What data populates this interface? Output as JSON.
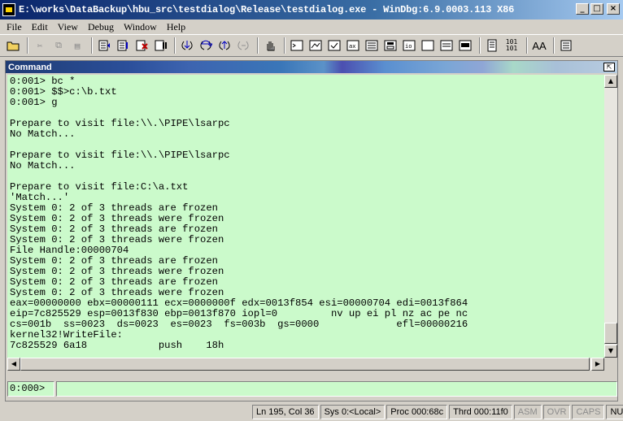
{
  "window": {
    "title": "E:\\works\\DataBackup\\hbu_src\\testdialog\\Release\\testdialog.exe - WinDbg:6.9.0003.113 X86",
    "minimize_label": "_",
    "maximize_label": "□",
    "close_label": "×"
  },
  "menu": {
    "items": [
      "File",
      "Edit",
      "View",
      "Debug",
      "Window",
      "Help"
    ]
  },
  "toolbar": {
    "buttons": [
      "open",
      "cut",
      "copy",
      "paste",
      "step-into",
      "step-over",
      "step-out",
      "run-to-cursor",
      "break",
      "call-stack",
      "source-mode",
      "command",
      "watch",
      "locals",
      "registers",
      "memory",
      "scratch-pad",
      "disassembly",
      "font",
      "options"
    ],
    "binary_label": "101\n101",
    "font_label": "AA"
  },
  "command_window": {
    "title": "Command",
    "close_icon": "⇱",
    "lines": [
      "0:001> bc *",
      "0:001> $$>c:\\b.txt",
      "0:001> g",
      "",
      "Prepare to visit file:\\\\.\\PIPE\\lsarpc",
      "No Match...",
      "",
      "Prepare to visit file:\\\\.\\PIPE\\lsarpc",
      "No Match...",
      "",
      "Prepare to visit file:C:\\a.txt",
      "'Match...'",
      "System 0: 2 of 3 threads are frozen",
      "System 0: 2 of 3 threads were frozen",
      "System 0: 2 of 3 threads are frozen",
      "System 0: 2 of 3 threads were frozen",
      "File Handle:00000704",
      "System 0: 2 of 3 threads are frozen",
      "System 0: 2 of 3 threads were frozen",
      "System 0: 2 of 3 threads are frozen",
      "System 0: 2 of 3 threads were frozen",
      "eax=00000000 ebx=00000111 ecx=0000000f edx=0013f854 esi=00000704 edi=0013f864",
      "eip=7c825529 esp=0013f830 ebp=0013f870 iopl=0         nv up ei pl nz ac pe nc",
      "cs=001b  ss=0023  ds=0023  es=0023  fs=003b  gs=0000             efl=00000216",
      "kernel32!WriteFile:",
      "7c825529 6a18            push    18h"
    ],
    "prompt": "0:000>",
    "input_value": ""
  },
  "status": {
    "position": "Ln 195, Col 36",
    "system": "Sys 0:<Local>",
    "process": "Proc 000:68c",
    "thread": "Thrd 000:11f0",
    "asm": "ASM",
    "ovr": "OVR",
    "caps": "CAPS",
    "num": "NUM"
  }
}
